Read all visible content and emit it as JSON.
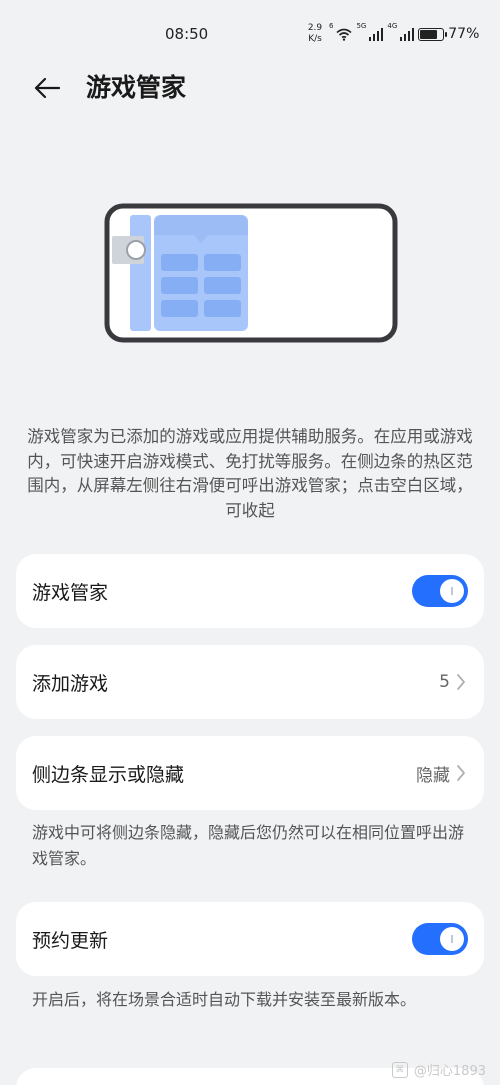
{
  "status_bar": {
    "time": "08:50",
    "net_speed_value": "2.9",
    "net_speed_unit": "K/s",
    "wifi_tag": "6",
    "sim1_tag": "5G",
    "sim2_tag": "4G",
    "battery_percent": "77%",
    "battery_level": 0.77
  },
  "header": {
    "back_icon": "arrow-left-icon",
    "title": "游戏管家"
  },
  "illustration": {
    "icon": "phone-landscape-sidebar-illustration",
    "accent_color": "#a9c6fa"
  },
  "description": "游戏管家为已添加的游戏或应用提供辅助服务。在应用或游戏内，可快速开启游戏模式、免打扰等服务。在侧边条的热区范围内，从屏幕左侧往右滑便可呼出游戏管家；点击空白区域，可收起",
  "settings": {
    "game_manager": {
      "label": "游戏管家",
      "enabled": true
    },
    "add_games": {
      "label": "添加游戏",
      "value": "5"
    },
    "sidebar_visibility": {
      "label": "侧边条显示或隐藏",
      "value": "隐藏",
      "note": "游戏中可将侧边条隐藏，隐藏后您仍然可以在相同位置呼出游戏管家。"
    },
    "scheduled_update": {
      "label": "预约更新",
      "enabled": true,
      "note": "开启后，将在场景合适时自动下载并安装至最新版本。"
    }
  },
  "watermark": {
    "text": "@归心1893",
    "logo_icon": "weibo-logo-icon"
  },
  "colors": {
    "accent": "#256fff",
    "background": "#f1f2f4",
    "card": "#ffffff"
  }
}
